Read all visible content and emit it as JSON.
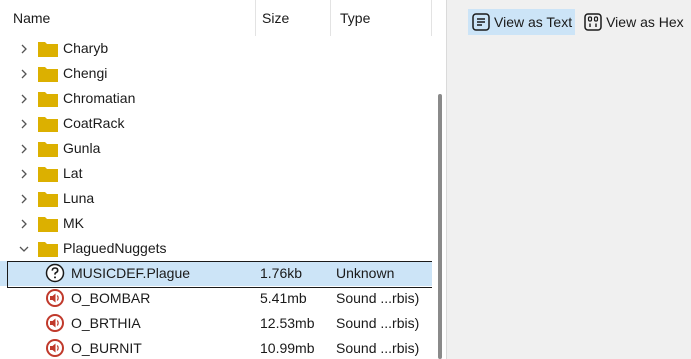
{
  "columns": {
    "name": "Name",
    "size": "Size",
    "type": "Type"
  },
  "folders": [
    {
      "label": "Charyb",
      "expanded": false
    },
    {
      "label": "Chengi",
      "expanded": false
    },
    {
      "label": "Chromatian",
      "expanded": false
    },
    {
      "label": "CoatRack",
      "expanded": false
    },
    {
      "label": "Gunla",
      "expanded": false
    },
    {
      "label": "Lat",
      "expanded": false
    },
    {
      "label": "Luna",
      "expanded": false
    },
    {
      "label": "MK",
      "expanded": false
    },
    {
      "label": "PlaguedNuggets",
      "expanded": true
    }
  ],
  "files": [
    {
      "name": "MUSICDEF.Plague",
      "size": "1.76kb",
      "type": "Unknown",
      "icon": "unknown-file-icon",
      "selected": true
    },
    {
      "name": "O_BOMBAR",
      "size": "5.41mb",
      "type": "Sound ...rbis)",
      "icon": "sound-file-icon",
      "selected": false
    },
    {
      "name": "O_BRTHIA",
      "size": "12.53mb",
      "type": "Sound ...rbis)",
      "icon": "sound-file-icon",
      "selected": false
    },
    {
      "name": "O_BURNIT",
      "size": "10.99mb",
      "type": "Sound ...rbis)",
      "icon": "sound-file-icon",
      "selected": false
    }
  ],
  "toolbar": {
    "view_text_label": "View as Text",
    "view_hex_label": "View as Hex"
  },
  "colors": {
    "folder": "#dcb000",
    "sound": "#c0392b",
    "selection": "#cce4f7"
  }
}
